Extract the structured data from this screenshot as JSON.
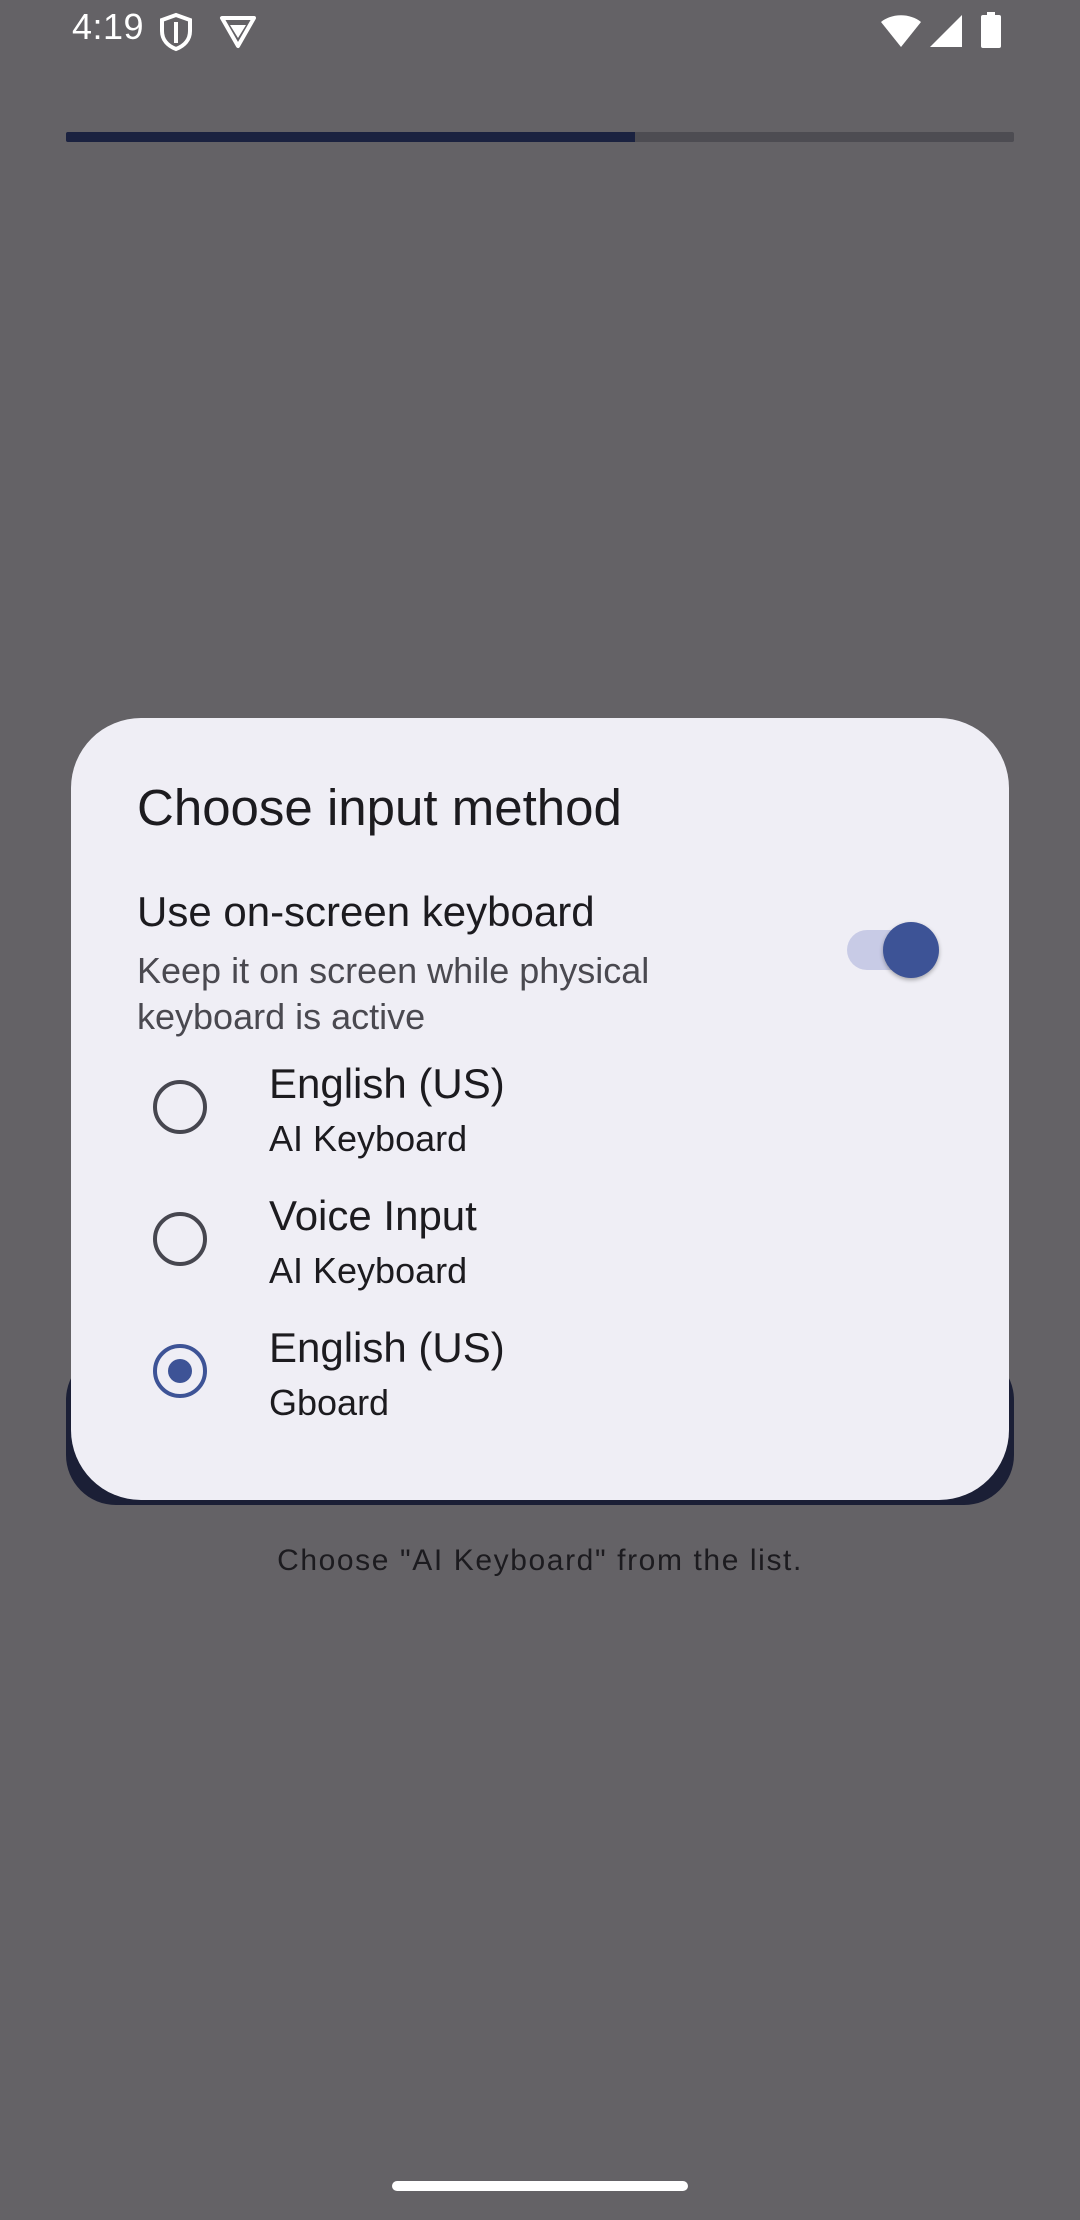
{
  "status_bar": {
    "time": "4:19",
    "icons": [
      "shield-icon",
      "vpn-icon",
      "wifi-icon",
      "signal-icon",
      "battery-icon"
    ]
  },
  "progress": {
    "value": 0.6
  },
  "background": {
    "instruction": "Choose \"AI Keyboard\" from the list."
  },
  "dialog": {
    "title": "Choose input method",
    "keyboard_toggle": {
      "title": "Use on-screen keyboard",
      "subtitle": "Keep it on screen while physical keyboard is active",
      "enabled": true
    },
    "options": [
      {
        "title": "English (US)",
        "subtitle": "AI Keyboard",
        "selected": false
      },
      {
        "title": "Voice Input",
        "subtitle": "AI Keyboard",
        "selected": false
      },
      {
        "title": "English (US)",
        "subtitle": "Gboard",
        "selected": true
      }
    ]
  },
  "colors": {
    "scrim": "#646266",
    "dialog_bg": "#efeef5",
    "accent": "#3d5396",
    "progress_fill": "#1b2240"
  }
}
